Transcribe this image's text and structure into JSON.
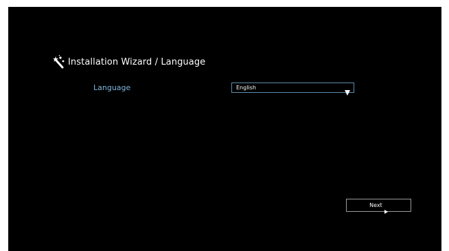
{
  "wizard": {
    "icon": "magic-wand-icon",
    "title": "Installation Wizard / Language"
  },
  "language": {
    "label": "Language",
    "selected": "English",
    "dropdown_icon": "triangle-down-icon"
  },
  "navigation": {
    "next_label": "Next",
    "next_icon": "triangle-right-icon"
  },
  "colors": {
    "background": "#000000",
    "label_accent": "#7fb6de",
    "select_border": "#5f8fae",
    "text": "#ffffff"
  }
}
